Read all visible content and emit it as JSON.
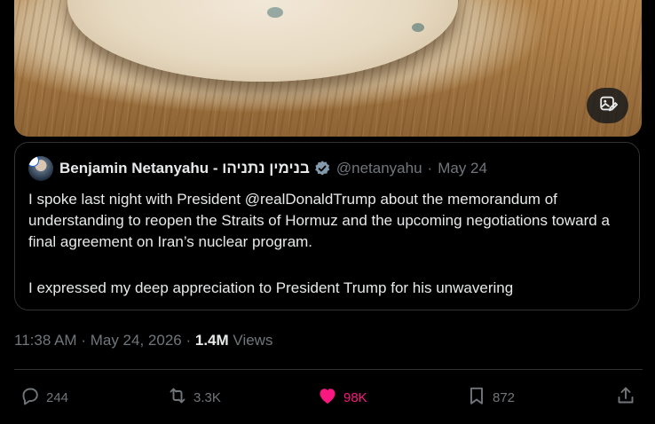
{
  "quoted": {
    "name": "Benjamin Netanyahu - בנימין נתניהו",
    "handle": "@netanyahu",
    "separator": "·",
    "date": "May 24",
    "text_lines": [
      "I spoke last night with President @realDonaldTrump about the memorandum of understanding to reopen the Straits of Hormuz and the upcoming negotiations toward a final agreement on Iran’s nuclear program.",
      "I expressed my deep appreciation to President Trump for his unwavering"
    ]
  },
  "meta": {
    "time": "11:38 AM",
    "sep1": "·",
    "date": "May 24, 2026",
    "sep2": "·",
    "views_count": "1.4M",
    "views_label": "Views"
  },
  "actions": {
    "replies": "244",
    "reposts": "3.3K",
    "likes": "98K",
    "bookmarks": "872"
  },
  "colors": {
    "background": "#000000",
    "text": "#e7e9ea",
    "secondary": "#71767b",
    "border": "#2f3336",
    "like": "#f91880",
    "verified": "#829aab"
  },
  "icons": [
    "media-edit-icon",
    "verified-badge-icon",
    "reply-icon",
    "repost-icon",
    "like-heart-icon",
    "bookmark-icon",
    "share-icon"
  ]
}
